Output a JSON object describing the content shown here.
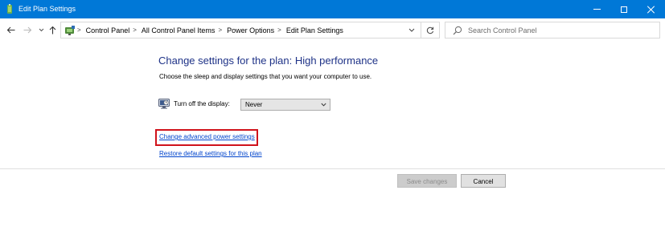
{
  "window": {
    "title": "Edit Plan Settings",
    "accent_color": "#0078d7",
    "controls": [
      "minimize-icon",
      "maximize-icon",
      "close-icon"
    ]
  },
  "navigation": {
    "icons": [
      "back-arrow-icon",
      "forward-arrow-icon",
      "recent-locations-chevron-icon",
      "up-arrow-icon"
    ],
    "address_icon": "control-panel-icon",
    "breadcrumbs": [
      "Control Panel",
      "All Control Panel Items",
      "Power Options",
      "Edit Plan Settings"
    ],
    "search": {
      "placeholder": "Search Control Panel",
      "value": ""
    }
  },
  "content": {
    "heading": "Change settings for the plan: High performance",
    "heading_color": "#1e3287",
    "subtitle": "Choose the sleep and display settings that you want your computer to use.",
    "display_setting": {
      "icon": "monitor-icon",
      "label": "Turn off the display:",
      "selected": "Never"
    },
    "links": {
      "advanced": "Change advanced power settings",
      "restore": "Restore default settings for this plan",
      "color": "#0044cc"
    },
    "highlight_color": "#d0121b"
  },
  "footer": {
    "save_label": "Save changes",
    "save_enabled": false,
    "cancel_label": "Cancel"
  }
}
